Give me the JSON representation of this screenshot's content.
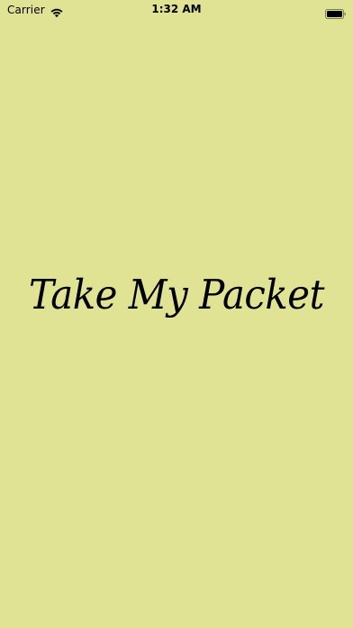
{
  "status_bar": {
    "carrier": "Carrier",
    "time": "1:32 AM",
    "wifi_icon": "wifi-icon",
    "battery_icon": "battery-icon"
  },
  "splash": {
    "title": "Take My Packet"
  },
  "colors": {
    "background": "#e0e294",
    "text": "#000000"
  }
}
